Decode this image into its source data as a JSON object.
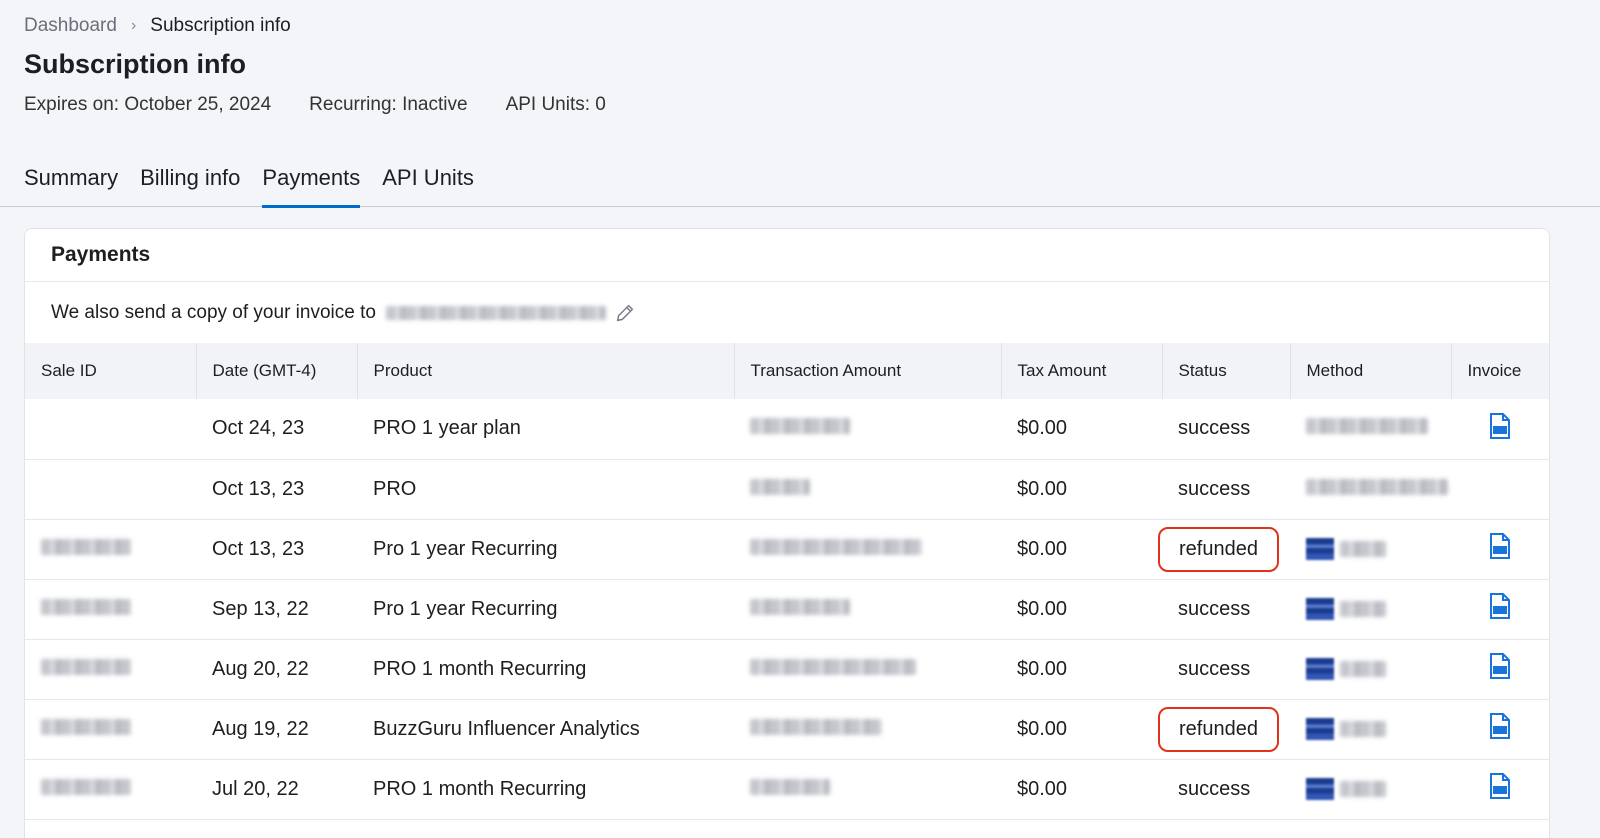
{
  "breadcrumb": {
    "root": "Dashboard",
    "current": "Subscription info"
  },
  "page": {
    "title": "Subscription info",
    "expires": "Expires on: October 25, 2024",
    "recurring": "Recurring: Inactive",
    "api_units": "API Units: 0"
  },
  "tabs": [
    {
      "label": "Summary"
    },
    {
      "label": "Billing info"
    },
    {
      "label": "Payments",
      "active": true
    },
    {
      "label": "API Units"
    }
  ],
  "payments": {
    "title": "Payments",
    "invoice_note": "We also send a copy of your invoice to",
    "columns": [
      "Sale ID",
      "Date (GMT-4)",
      "Product",
      "Transaction Amount",
      "Tax Amount",
      "Status",
      "Method",
      "Invoice"
    ],
    "rows": [
      {
        "date": "Oct 24, 23",
        "product": "PRO 1 year plan",
        "tax": "$0.00",
        "status": "success"
      },
      {
        "date": "Oct 13, 23",
        "product": "PRO",
        "tax": "$0.00",
        "status": "success"
      },
      {
        "date": "Oct 13, 23",
        "product": "Pro 1 year Recurring",
        "tax": "$0.00",
        "status": "refunded"
      },
      {
        "date": "Sep 13, 22",
        "product": "Pro 1 year Recurring",
        "tax": "$0.00",
        "status": "success"
      },
      {
        "date": "Aug 20, 22",
        "product": "PRO 1 month Recurring",
        "tax": "$0.00",
        "status": "success"
      },
      {
        "date": "Aug 19, 22",
        "product": "BuzzGuru Influencer Analytics",
        "tax": "$0.00",
        "status": "refunded"
      },
      {
        "date": "Jul 20, 22",
        "product": "PRO 1 month Recurring",
        "tax": "$0.00",
        "status": "success"
      }
    ]
  },
  "colors": {
    "accent": "#006dca",
    "refund_highlight": "#e0331a",
    "pdf_icon": "#1a73d9"
  }
}
